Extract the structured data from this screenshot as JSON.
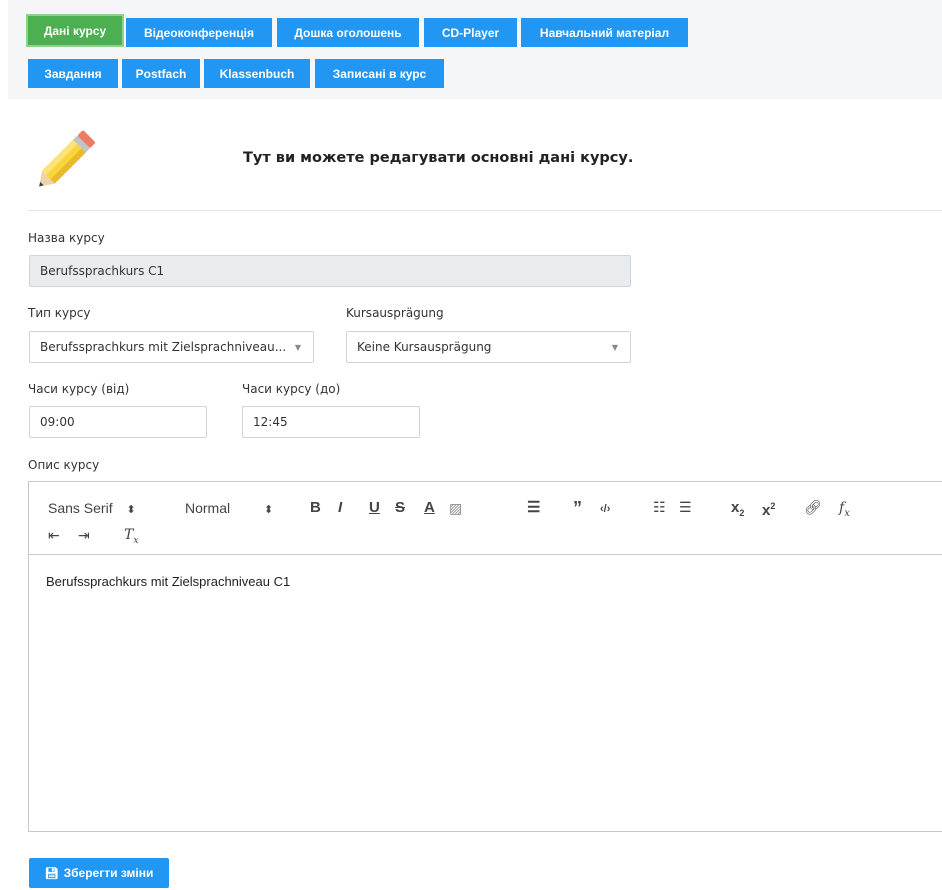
{
  "tabs": [
    {
      "label": "Дані курсу",
      "active": true
    },
    {
      "label": "Відеоконференція"
    },
    {
      "label": "Дошка оголошень"
    },
    {
      "label": "CD-Player"
    },
    {
      "label": "Навчальний матеріал"
    },
    {
      "label": "Завдання"
    },
    {
      "label": "Postfach"
    },
    {
      "label": "Klassenbuch"
    },
    {
      "label": "Записані в курс"
    }
  ],
  "colors": {
    "tab": "#2196f3",
    "tab_active": "#4caf50",
    "button": "#2196f3"
  },
  "intro_text": "Тут ви можете редагувати основні дані курсу.",
  "course_name": {
    "label": "Назва курсу",
    "value": "Berufssprachkurs C1"
  },
  "course_type": {
    "label": "Тип курсу",
    "value": "Berufssprachkurs mit Zielsprachniveau..."
  },
  "course_variant": {
    "label": "Kursausprägung",
    "value": "Keine Kursausprägung"
  },
  "hours_from": {
    "label": "Часи курсу (від)",
    "value": "09:00"
  },
  "hours_to": {
    "label": "Часи курсу (до)",
    "value": "12:45"
  },
  "description": {
    "label": "Опис курсу",
    "font": "Sans Serif",
    "size": "Normal",
    "content": "Berufssprachkurs mit Zielsprachniveau C1"
  },
  "save_label": "Зберегти зміни"
}
